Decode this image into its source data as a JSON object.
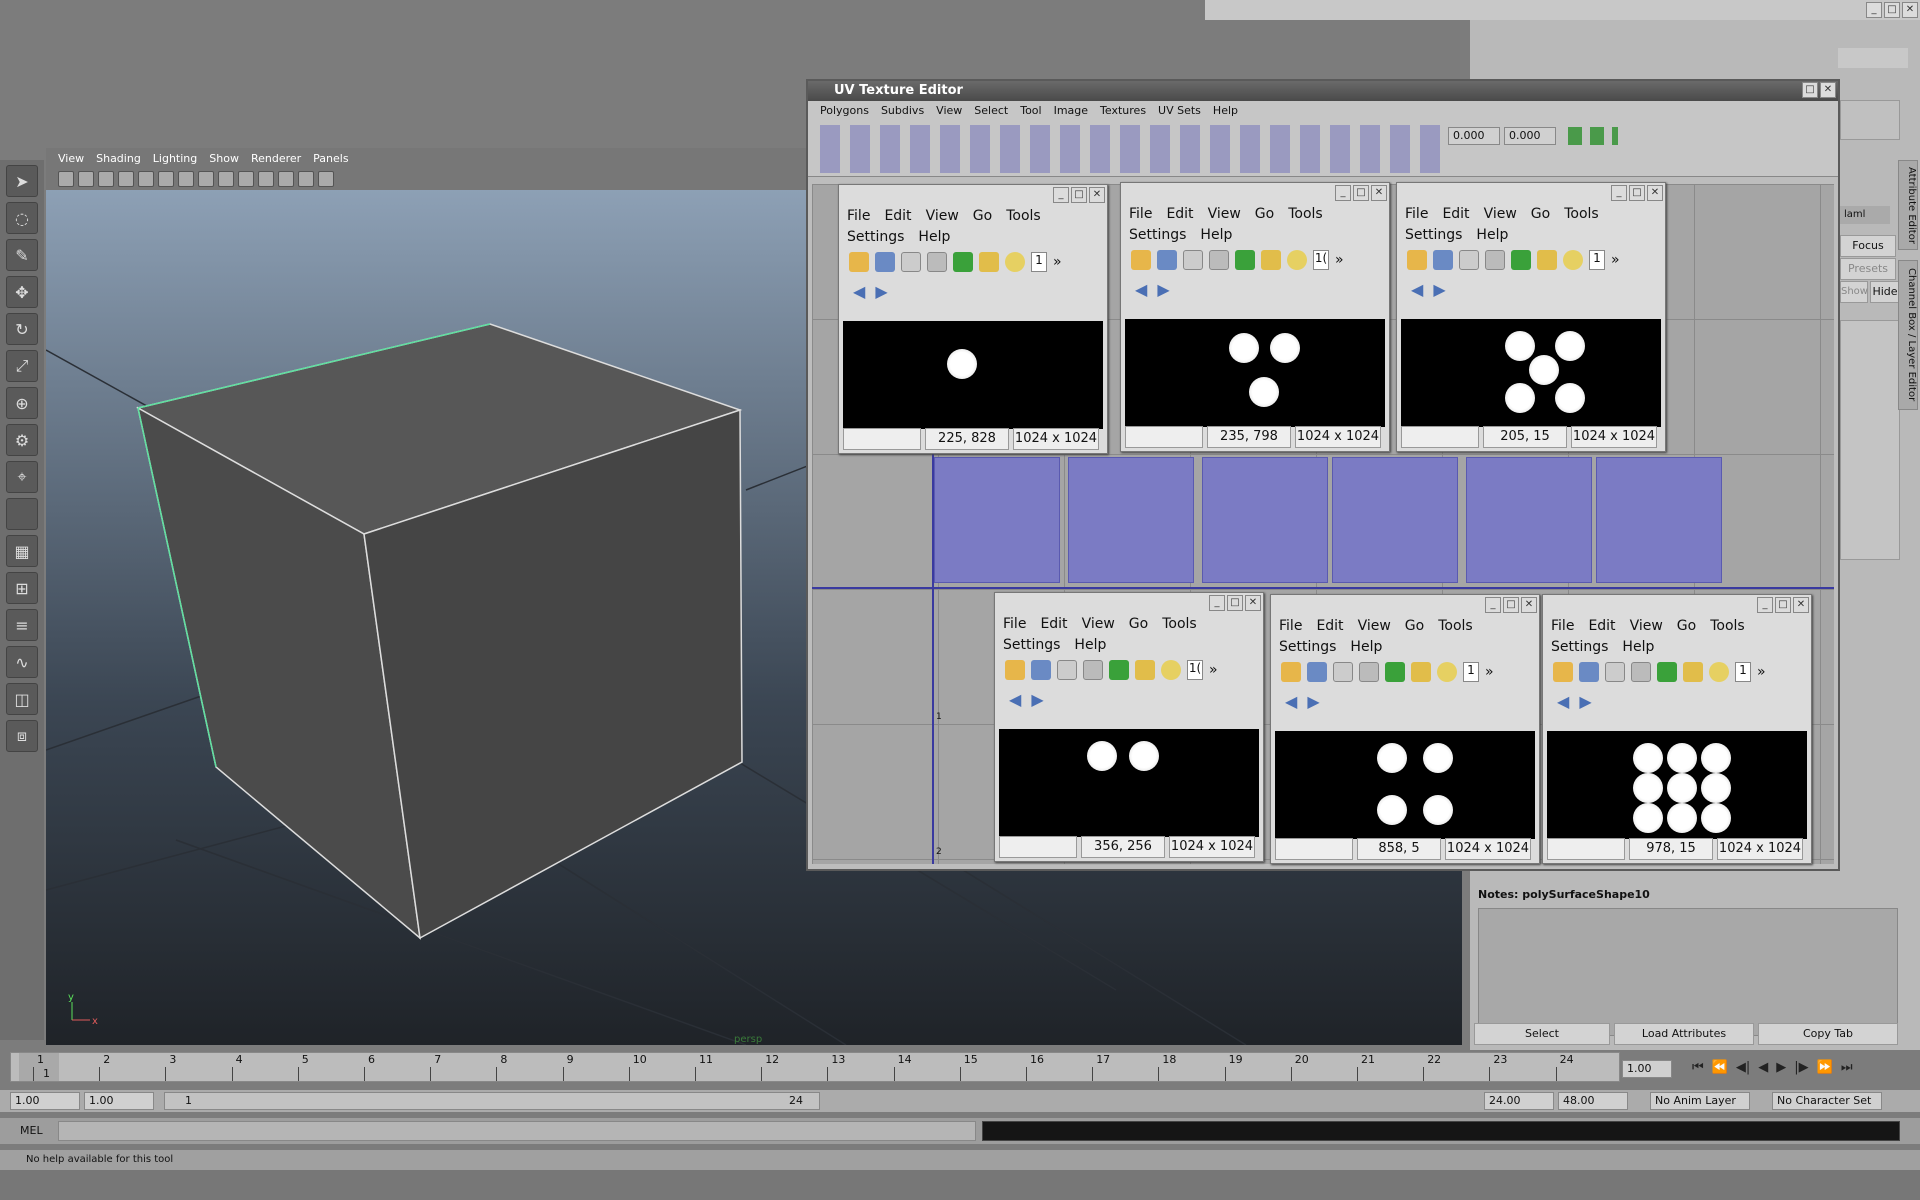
{
  "window": {
    "minimize": "_",
    "maximize": "□",
    "close": "✕"
  },
  "viewport": {
    "menus": [
      "View",
      "Shading",
      "Lighting",
      "Show",
      "Renderer",
      "Panels"
    ],
    "camera_label": "persp"
  },
  "uv_editor": {
    "title": "UV Texture Editor",
    "menus": [
      "Polygons",
      "Subdivs",
      "View",
      "Select",
      "Tool",
      "Image",
      "Textures",
      "UV Sets",
      "Help"
    ],
    "u_value": "0.000",
    "v_value": "0.000",
    "grid_labels": [
      "1",
      "2"
    ]
  },
  "image_viewers": [
    {
      "menus": [
        "File",
        "Edit",
        "View",
        "Go",
        "Tools"
      ],
      "menus2": [
        "Settings",
        "Help"
      ],
      "zoom": "1",
      "coords": "225, 828",
      "size": "1024 x 1024",
      "dots": 1
    },
    {
      "menus": [
        "File",
        "Edit",
        "View",
        "Go",
        "Tools"
      ],
      "menus2": [
        "Settings",
        "Help"
      ],
      "zoom": "1(",
      "coords": "235, 798",
      "size": "1024 x 1024",
      "dots": 3
    },
    {
      "menus": [
        "File",
        "Edit",
        "View",
        "Go",
        "Tools"
      ],
      "menus2": [
        "Settings",
        "Help"
      ],
      "zoom": "1",
      "coords": "205, 15",
      "size": "1024 x 1024",
      "dots": 5
    },
    {
      "menus": [
        "File",
        "Edit",
        "View",
        "Go",
        "Tools"
      ],
      "menus2": [
        "Settings",
        "Help"
      ],
      "zoom": "1(",
      "coords": "356, 256",
      "size": "1024 x 1024",
      "dots": 2
    },
    {
      "menus": [
        "File",
        "Edit",
        "View",
        "Go",
        "Tools"
      ],
      "menus2": [
        "Settings",
        "Help"
      ],
      "zoom": "1",
      "coords": "858, 5",
      "size": "1024 x 1024",
      "dots": 4
    },
    {
      "menus": [
        "File",
        "Edit",
        "View",
        "Go",
        "Tools"
      ],
      "menus2": [
        "Settings",
        "Help"
      ],
      "zoom": "1",
      "coords": "978, 15",
      "size": "1024 x 1024",
      "dots": 9
    }
  ],
  "right_panel": {
    "focus_label": "Focus",
    "presets_label": "Presets",
    "show_label": "Show",
    "hide_label": "Hide",
    "layer_label": "laml",
    "notes_label": "Notes:",
    "notes_value": "polySurfaceShape10",
    "select_button": "Select",
    "load_attributes_button": "Load Attributes",
    "copy_tab_button": "Copy Tab",
    "tab_attribute_editor": "Attribute Editor",
    "tab_channel_box": "Channel Box / Layer Editor"
  },
  "timeline": {
    "ticks": [
      "1",
      "2",
      "3",
      "4",
      "5",
      "6",
      "7",
      "8",
      "9",
      "10",
      "11",
      "12",
      "13",
      "14",
      "15",
      "16",
      "17",
      "18",
      "19",
      "20",
      "21",
      "22",
      "23",
      "24"
    ],
    "current_frame_marker": "1",
    "current_frame_field": "1.00"
  },
  "range": {
    "start_time": "1.00",
    "playback_start": "1.00",
    "slider_start": "1",
    "slider_end": "24",
    "playback_end": "24.00",
    "end_time": "48.00",
    "anim_layer": "No Anim Layer",
    "character_set": "No Character Set"
  },
  "mel": {
    "label": "MEL"
  },
  "status": {
    "help_line": "No help available for this tool"
  }
}
